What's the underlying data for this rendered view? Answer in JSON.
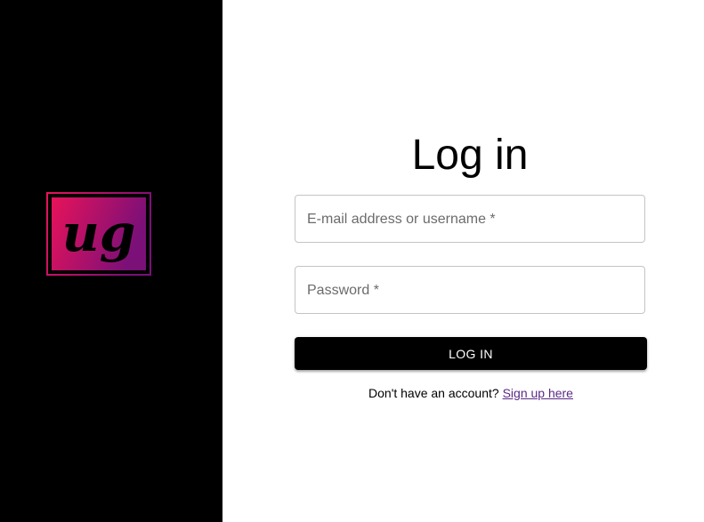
{
  "logo": {
    "text": "UG",
    "gradient_start": "#e8125a",
    "gradient_end": "#7a1078",
    "panel_color": "#000000"
  },
  "form": {
    "title": "Log in",
    "email_label": "E-mail address or username *",
    "email_value": "",
    "password_label": "Password *",
    "password_value": "",
    "login_button_label": "LOG IN",
    "signup_prompt": "Don't have an account?",
    "signup_link_label": "Sign up here"
  },
  "colors": {
    "button_bg": "#000000",
    "button_text": "#ffffff",
    "link": "#5b2a86",
    "field_border": "#c4c4c4"
  }
}
